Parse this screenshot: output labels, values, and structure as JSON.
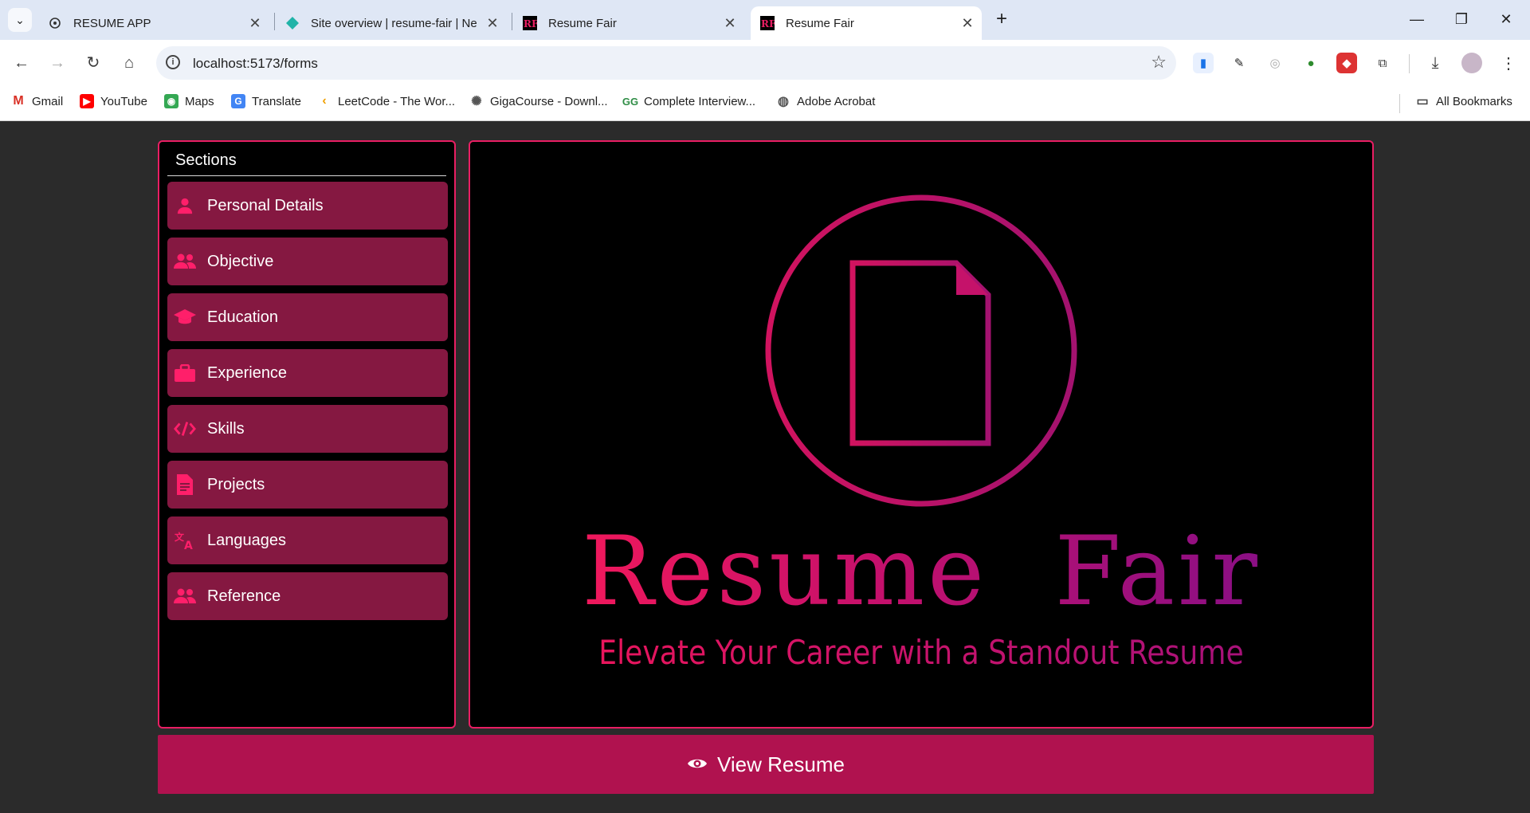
{
  "browser": {
    "tabs": [
      {
        "title": "RESUME APP",
        "favicon": "openai-icon",
        "active": false
      },
      {
        "title": "Site overview | resume-fair | Ne",
        "favicon": "netlify-icon",
        "active": false
      },
      {
        "title": "Resume Fair",
        "favicon": "rf-logo-icon",
        "active": false
      },
      {
        "title": "Resume Fair",
        "favicon": "rf-logo-icon",
        "active": true
      }
    ],
    "url": "localhost:5173/forms",
    "bookmarks": [
      {
        "label": "Gmail",
        "icon": "gmail-icon"
      },
      {
        "label": "YouTube",
        "icon": "youtube-icon"
      },
      {
        "label": "Maps",
        "icon": "maps-icon"
      },
      {
        "label": "Translate",
        "icon": "translate-icon"
      },
      {
        "label": "LeetCode - The Wor...",
        "icon": "leetcode-icon"
      },
      {
        "label": "GigaCourse - Downl...",
        "icon": "gigacourse-icon"
      },
      {
        "label": "Complete Interview...",
        "icon": "gfg-icon"
      },
      {
        "label": "Adobe Acrobat",
        "icon": "globe-icon"
      }
    ],
    "all_bookmarks": "All Bookmarks"
  },
  "sidebar": {
    "heading": "Sections",
    "items": [
      {
        "label": "Personal Details",
        "icon": "person-icon"
      },
      {
        "label": "Objective",
        "icon": "people-icon"
      },
      {
        "label": "Education",
        "icon": "graduation-cap-icon"
      },
      {
        "label": "Experience",
        "icon": "briefcase-icon"
      },
      {
        "label": "Skills",
        "icon": "code-icon"
      },
      {
        "label": "Projects",
        "icon": "document-icon"
      },
      {
        "label": "Languages",
        "icon": "translate-icon"
      },
      {
        "label": "Reference",
        "icon": "people-icon"
      }
    ]
  },
  "brand": {
    "title": "Resume  Fair",
    "tagline": "Elevate Your Career with a Standout Resume"
  },
  "view_button": {
    "label": "View Resume",
    "icon": "eye-icon"
  },
  "colors": {
    "accent": "#e91e63",
    "section_bg": "#851841",
    "button_bg": "#b0124f",
    "page_bg": "#2b2b2b"
  }
}
